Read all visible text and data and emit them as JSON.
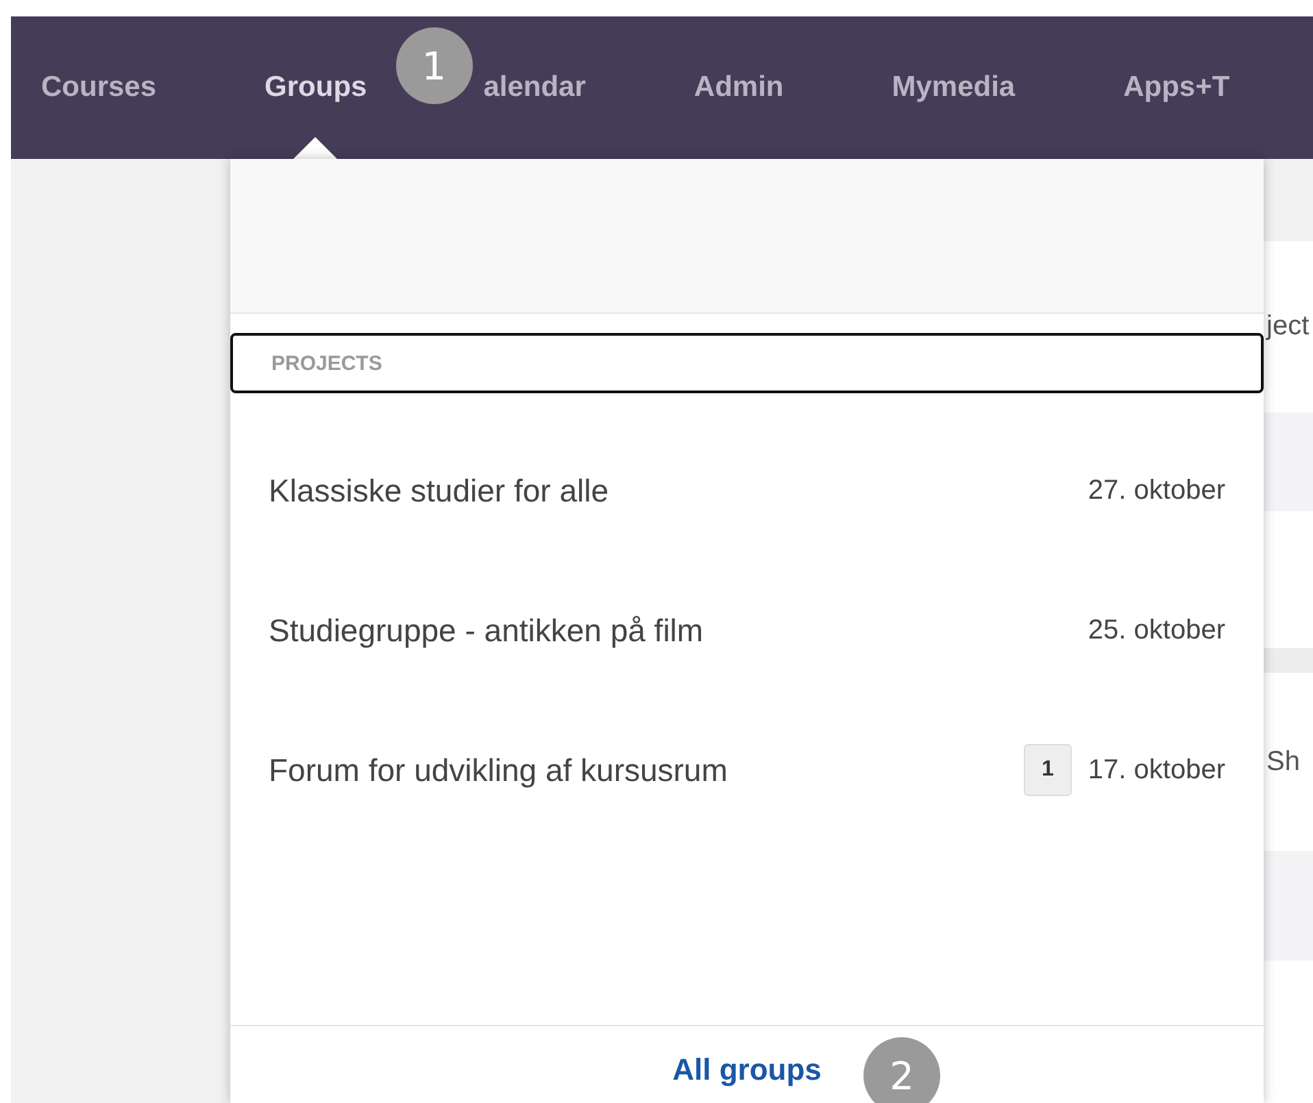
{
  "nav": {
    "callout": "1",
    "items": [
      {
        "label": "Courses",
        "selected": false
      },
      {
        "label": "Groups",
        "selected": true
      },
      {
        "label": "alendar",
        "selected": false
      },
      {
        "label": "Admin",
        "selected": false
      },
      {
        "label": "Mymedia",
        "selected": false
      },
      {
        "label": "Apps+T",
        "selected": false
      }
    ]
  },
  "menu": {
    "section": {
      "label": "PROJECTS",
      "focused": true
    },
    "rows": [
      {
        "title": "Klassiske studier for alle",
        "date": "27. oktober"
      },
      {
        "title": "Studiegruppe - antikken på film",
        "date": "25. oktober"
      },
      {
        "title": "Forum for udvikling af kursusrum",
        "badge": "1",
        "date": "17. oktober"
      }
    ],
    "footer": {
      "link": "All groups",
      "callout": "2"
    }
  },
  "background": {
    "texts": [
      "ject",
      "Sh"
    ]
  }
}
